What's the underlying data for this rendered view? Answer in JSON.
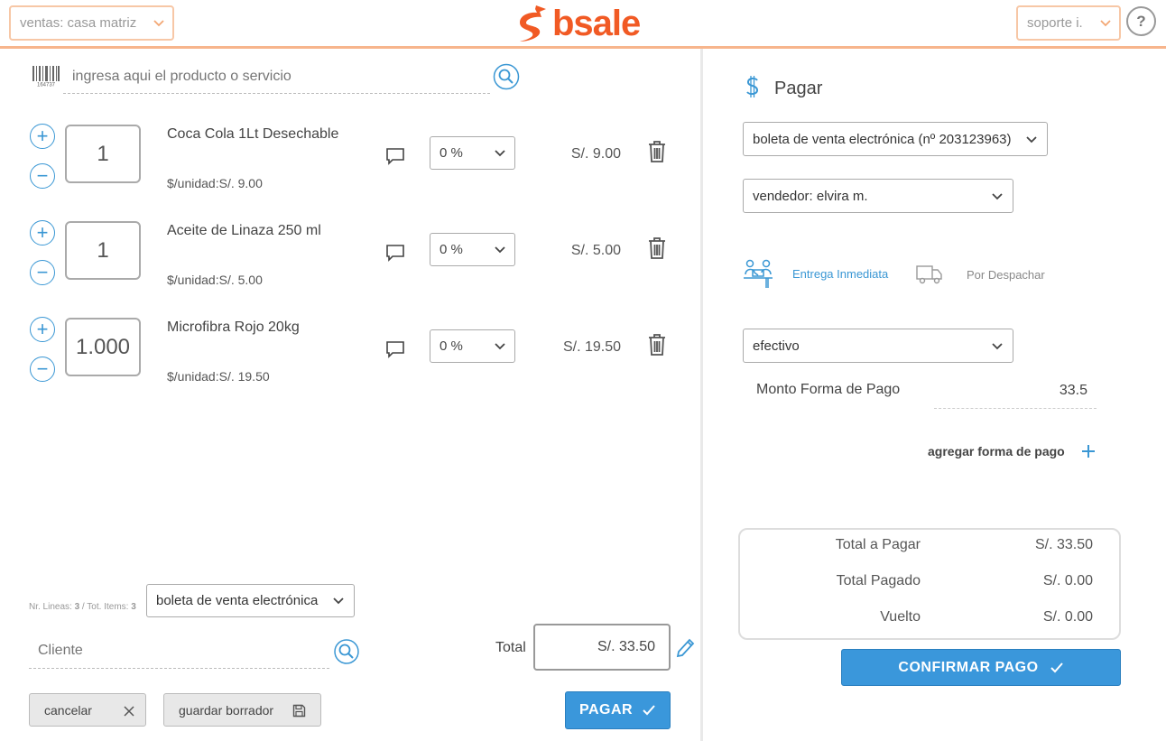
{
  "header": {
    "branch_select": "ventas: casa matriz",
    "logo_text": "bsale",
    "user_select": "soporte i.",
    "help_label": "?"
  },
  "search": {
    "placeholder": "ingresa aqui el producto o servicio"
  },
  "items": [
    {
      "qty": "1",
      "name": "Coca Cola 1Lt Desechable",
      "unit_price": "$/unidad:S/. 9.00",
      "discount": "0 %",
      "total": "S/. 9.00"
    },
    {
      "qty": "1",
      "name": "Aceite de Linaza 250 ml",
      "unit_price": "$/unidad:S/. 5.00",
      "discount": "0 %",
      "total": "S/. 5.00"
    },
    {
      "qty": "1.000",
      "name": "Microfibra Rojo 20kg",
      "unit_price": "$/unidad:S/. 19.50",
      "discount": "0 %",
      "total": "S/. 19.50"
    }
  ],
  "footer": {
    "lines_label": "Nr. Lineas: ",
    "lines_value": "3",
    "items_label": " / Tot. Items: ",
    "items_value": "3",
    "doc_type": "boleta de venta electrónica",
    "client_placeholder": "Cliente",
    "total_label": "Total",
    "total_value": "S/. 33.50",
    "cancel_label": "cancelar",
    "draft_label": "guardar borrador",
    "pay_label": "PAGAR"
  },
  "payment": {
    "title": "Pagar",
    "document_select": "boleta de venta electrónica (nº 203123963)",
    "seller_select": "vendedor: elvira m.",
    "delivery_immediate": "Entrega Inmediata",
    "delivery_dispatch": "Por Despachar",
    "method_select": "efectivo",
    "amount_label": "Monto Forma de Pago",
    "amount_value": "33.5",
    "add_method_label": "agregar forma de pago",
    "total_to_pay_label": "Total a Pagar",
    "total_to_pay_value": "S/. 33.50",
    "total_paid_label": "Total Pagado",
    "total_paid_value": "S/. 0.00",
    "change_label": "Vuelto",
    "change_value": "S/. 0.00",
    "confirm_label": "CONFIRMAR PAGO"
  },
  "colors": {
    "accent_blue": "#3a97db",
    "brand_orange": "#f15a24",
    "header_border": "#f7b58c"
  }
}
